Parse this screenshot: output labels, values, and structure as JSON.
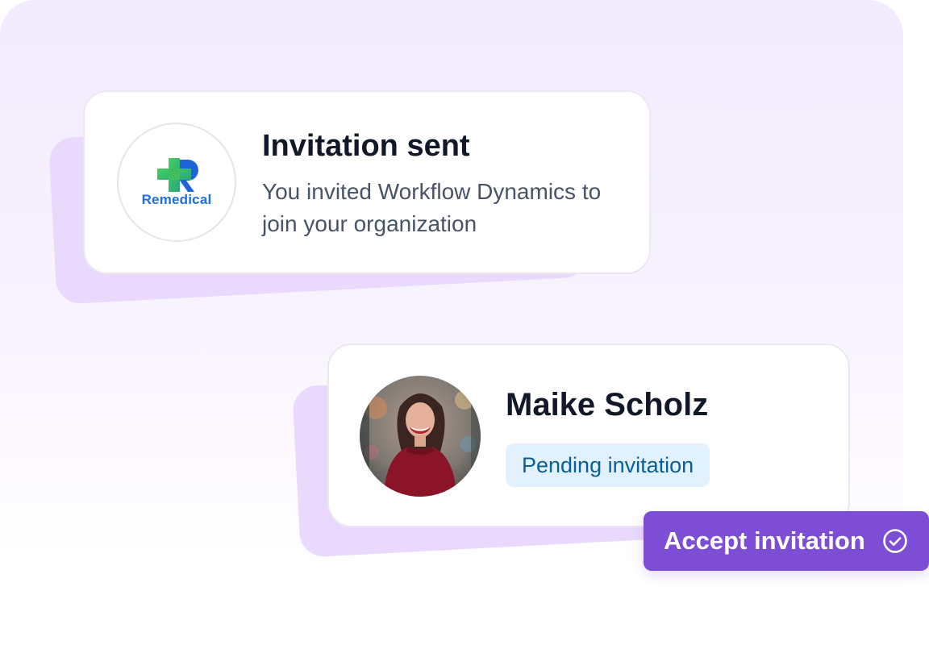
{
  "invitation_card": {
    "logo": {
      "icon": "medical-cross-r-logo-icon",
      "brand_text": "Remedical"
    },
    "title": "Invitation sent",
    "description": "You invited Workflow Dynamics to join your organization"
  },
  "member_card": {
    "avatar_icon": "user-avatar-photo",
    "name": "Maike Scholz",
    "status_badge": "Pending invitation"
  },
  "accept_button": {
    "label": "Accept invitation",
    "icon": "check-circle-icon"
  },
  "colors": {
    "accent_purple": "#7d4dd6",
    "card_shadow": "#e9d9fc",
    "badge_bg": "#e1f1fd",
    "badge_text": "#0a5f97",
    "brand_blue": "#1c6fe0",
    "brand_green": "#3cc86a",
    "title_text": "#111827",
    "body_text": "#475467"
  }
}
